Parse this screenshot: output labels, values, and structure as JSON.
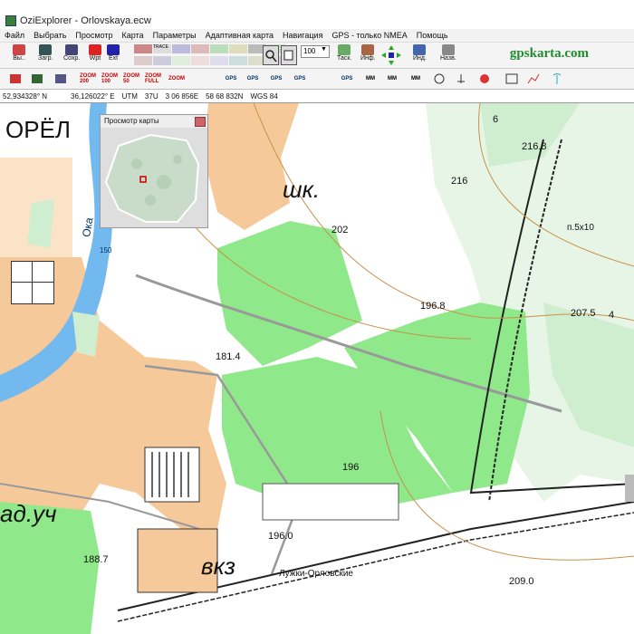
{
  "window": {
    "title": "OziExplorer - Orlovskaya.ecw"
  },
  "menu": [
    "Файл",
    "Выбрать",
    "Просмотр",
    "Карта",
    "Параметры",
    "Адаптивная карта",
    "Навигация",
    "GPS - только NMEA",
    "Помощь"
  ],
  "toolbar": {
    "buttons": [
      {
        "label": "Вы..",
        "icon": "save-icon"
      },
      {
        "label": "Загр.",
        "icon": "load-icon"
      },
      {
        "label": "Сохр.",
        "icon": "save-disk-icon"
      },
      {
        "label": "Wpt",
        "icon": "waypoint-icon"
      },
      {
        "label": "Ext",
        "icon": "extra-icon"
      },
      {
        "label": "Таск.",
        "icon": "track-icon"
      },
      {
        "label": "Инф.",
        "icon": "info-icon"
      },
      {
        "label": "Инд.",
        "icon": "indicator-icon"
      },
      {
        "label": "Назв.",
        "icon": "names-icon"
      }
    ],
    "trace_label": "TRACE",
    "zoom_value": "100",
    "brand": "gpskarta.com",
    "zoom_buttons": [
      "ZOOM 200",
      "ZOOM 100",
      "ZOOM 50",
      "ZOOM FULL",
      "ZOOM"
    ],
    "gps_labels": [
      "GPS",
      "GPS",
      "GPS",
      "GPS",
      "GPS"
    ],
    "mm_labels": [
      "MM",
      "MM",
      "MM"
    ]
  },
  "status": {
    "lat": "52,934328° N",
    "lon": "36,126022° E",
    "utm": "UTM",
    "zone": "37U",
    "easting": "3 06 856E",
    "northing": "58 68 832N",
    "datum": "WGS 84"
  },
  "overview": {
    "title": "Просмотр карты"
  },
  "map_labels": {
    "city": "ОРЁЛ",
    "river": "Ока",
    "school": "шк.",
    "garden": "ад.уч",
    "station": "вкз",
    "station_name": "Лужки-Орловские",
    "elev_216_8": "216.8",
    "elev_216": "216",
    "elev_202": "202",
    "elev_196_8": "196.8",
    "elev_207_5": "207.5",
    "elev_181_4": "181.4",
    "elev_196": "196",
    "elev_196_0": "196.0",
    "elev_188_7": "188.7",
    "elev_209_0": "209.0",
    "elev_150": "150",
    "n6": "6",
    "n4": "4",
    "bridge": "п.5х10"
  },
  "colors": {
    "green": "#8fe88a",
    "orange": "#f2c08e",
    "river": "#72b9ef",
    "forest": "#cfeecf",
    "bg": "#ffffff"
  }
}
